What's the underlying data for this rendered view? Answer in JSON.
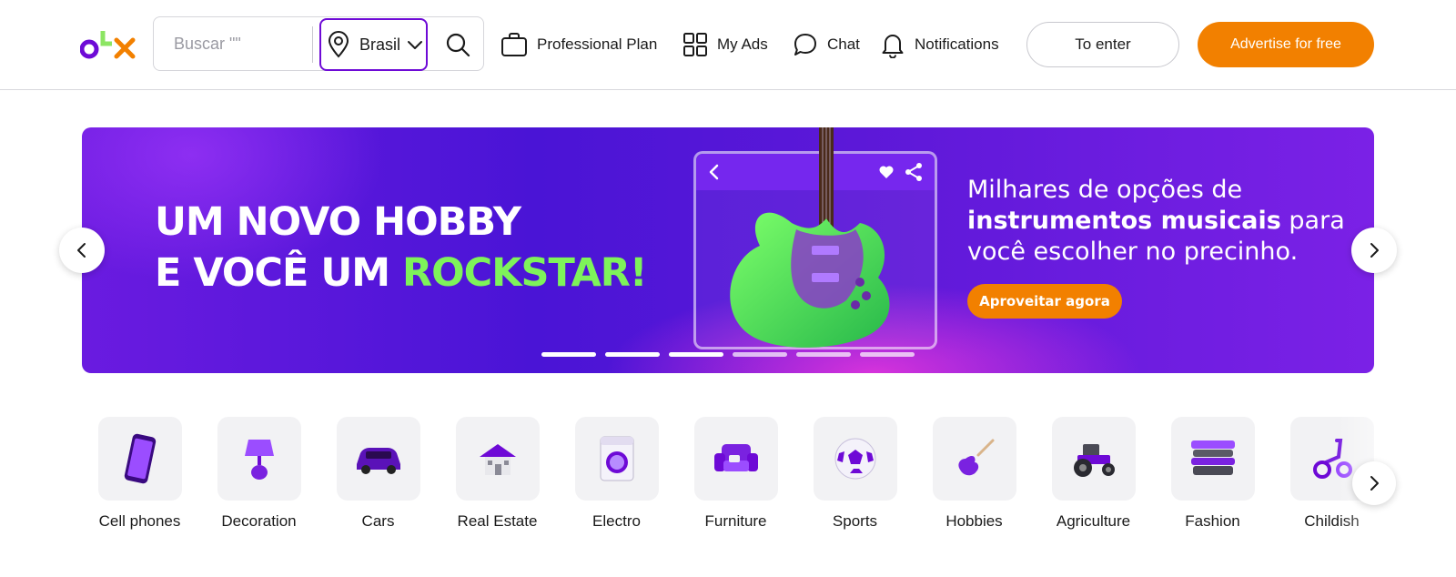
{
  "header": {
    "logo": {
      "text": "OLX",
      "colors": {
        "o": "#6e0ad6",
        "l": "#8ce563",
        "x": "#f28000"
      }
    },
    "search": {
      "placeholder": "Buscar \"\"",
      "value": "",
      "location": "Brasil"
    },
    "nav": [
      {
        "label": "Professional Plan",
        "icon": "briefcase-icon"
      },
      {
        "label": "My Ads",
        "icon": "grid-icon"
      },
      {
        "label": "Chat",
        "icon": "chat-bubble-icon"
      },
      {
        "label": "Notifications",
        "icon": "bell-icon"
      }
    ],
    "enter_label": "To enter",
    "advertise_label": "Advertise for free"
  },
  "banner": {
    "headline_line1": "UM NOVO HOBBY",
    "headline_line2_part1": "E VOCÊ UM ",
    "headline_line2_accent": "ROCKSTAR!",
    "sub_part1": "Milhares de opções de",
    "sub_bold": "instrumentos musicais",
    "sub_part2": " para",
    "sub_part3": "você escolher no precinho.",
    "cta_label": "Aproveitar agora",
    "dots": 6,
    "active_dot": 3
  },
  "categories": [
    {
      "label": "Cell phones",
      "icon": "smartphone-icon"
    },
    {
      "label": "Decoration",
      "icon": "lamp-icon"
    },
    {
      "label": "Cars",
      "icon": "car-icon"
    },
    {
      "label": "Real Estate",
      "icon": "house-icon"
    },
    {
      "label": "Electro",
      "icon": "washing-machine-icon"
    },
    {
      "label": "Furniture",
      "icon": "armchair-icon"
    },
    {
      "label": "Sports",
      "icon": "soccer-ball-icon"
    },
    {
      "label": "Hobbies",
      "icon": "guitar-icon"
    },
    {
      "label": "Agriculture",
      "icon": "tractor-icon"
    },
    {
      "label": "Fashion",
      "icon": "folded-clothes-icon"
    },
    {
      "label": "Childish",
      "icon": "tricycle-icon"
    }
  ],
  "colors": {
    "brand_purple": "#6e0ad6",
    "brand_orange": "#f28000",
    "brand_green": "#8ce563"
  }
}
